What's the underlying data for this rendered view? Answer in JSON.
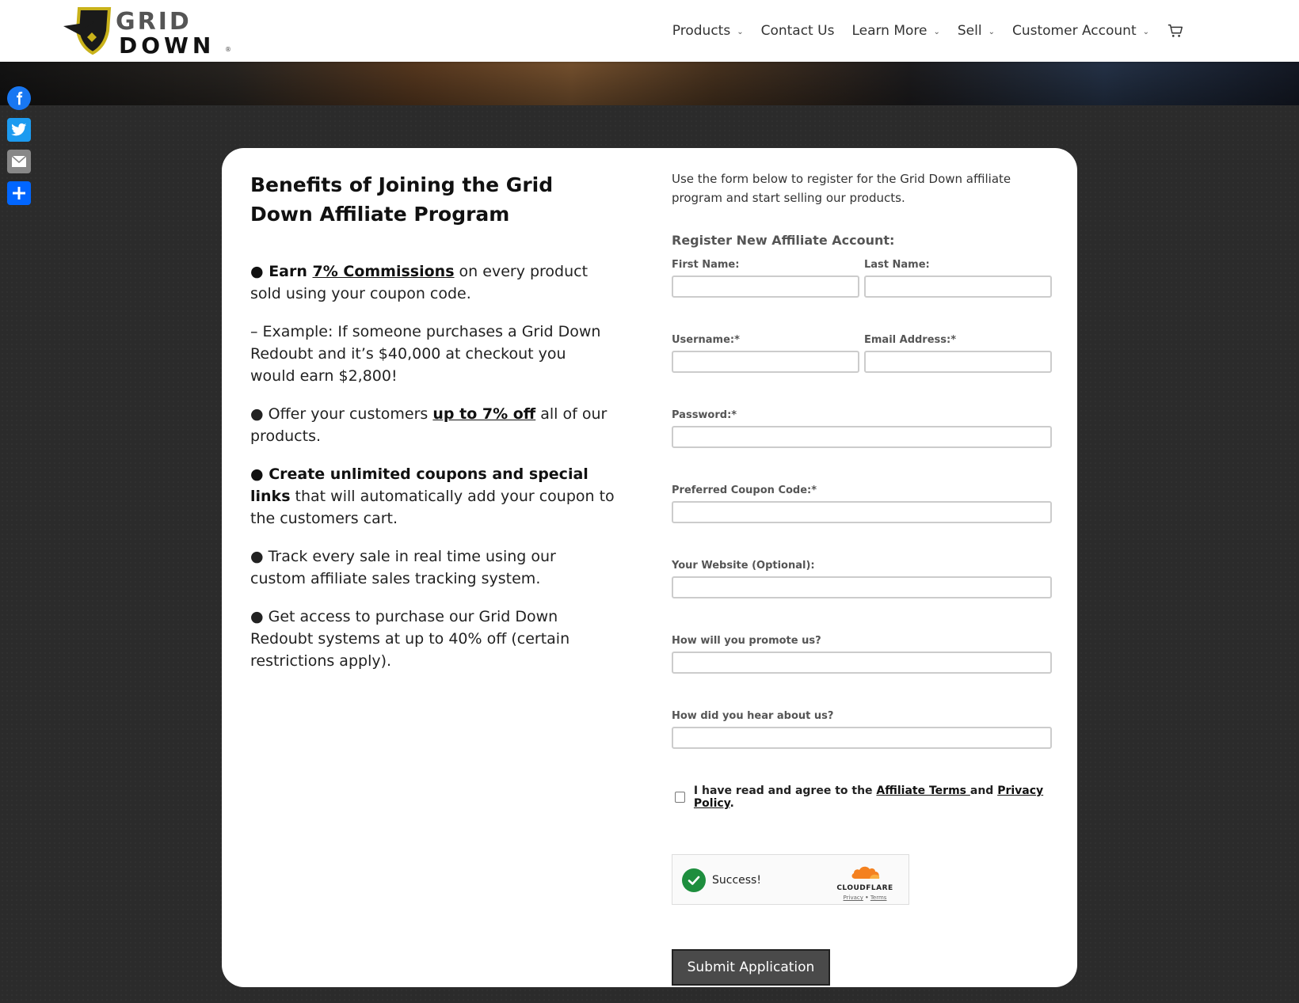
{
  "header": {
    "logo": {
      "top_text": "GRID",
      "bottom_text": "DOWN",
      "mark": "®",
      "alt": "Grid Down logo"
    },
    "nav": [
      {
        "label": "Products",
        "dropdown": true
      },
      {
        "label": "Contact Us",
        "dropdown": false
      },
      {
        "label": "Learn More",
        "dropdown": true
      },
      {
        "label": "Sell",
        "dropdown": true
      },
      {
        "label": "Customer Account",
        "dropdown": true
      }
    ],
    "cart_icon": "cart-icon"
  },
  "social": [
    {
      "name": "facebook-icon",
      "color": "#1877f2"
    },
    {
      "name": "twitter-icon",
      "color": "#1d9bf0"
    },
    {
      "name": "email-icon",
      "color": "#888888"
    },
    {
      "name": "share-icon",
      "color": "#0166ff"
    }
  ],
  "benefits": {
    "title": "Benefits of Joining the Grid Down Affiliate Program",
    "b1_strong": "● Earn ",
    "b1_link": "7% Commissions",
    "b1_rest": " on every product sold using your coupon code.",
    "b2": "– Example: If someone purchases a Grid Down Redoubt and it’s $40,000 at checkout you would earn $2,800!",
    "b3_pre": "● Offer your customers ",
    "b3_link": "up to 7% off",
    "b3_rest": " all of our products.",
    "b4_strong": "● Create unlimited coupons and special links",
    "b4_rest": " that will automatically add your coupon to the customers cart.",
    "b5": "● Track every sale in real time using our custom affiliate sales tracking system.",
    "b6": "● Get access to purchase our Grid Down Redoubt systems at up to 40% off (certain restrictions apply)."
  },
  "form": {
    "intro": "Use the form below to register for the Grid Down affiliate program and start selling our products.",
    "title": "Register New Affiliate Account:",
    "first_name_label": "First Name:",
    "last_name_label": "Last Name:",
    "username_label": "Username:*",
    "email_label": "Email Address:*",
    "password_label": "Password:*",
    "coupon_label": "Preferred Coupon Code:*",
    "website_label": "Your Website (Optional):",
    "promote_label": "How will you promote us?",
    "hear_label": "How did you hear about us?",
    "agree_pre": "I have read and agree to the ",
    "agree_terms": "Affiliate Terms ",
    "agree_and": "and ",
    "agree_privacy": "Privacy Policy",
    "agree_end": ".",
    "captcha_status": "Success!",
    "captcha_brand": "CLOUDFLARE",
    "captcha_privacy": "Privacy",
    "captcha_sep": "•",
    "captcha_terms": "Terms",
    "submit_label": "Submit Application"
  }
}
